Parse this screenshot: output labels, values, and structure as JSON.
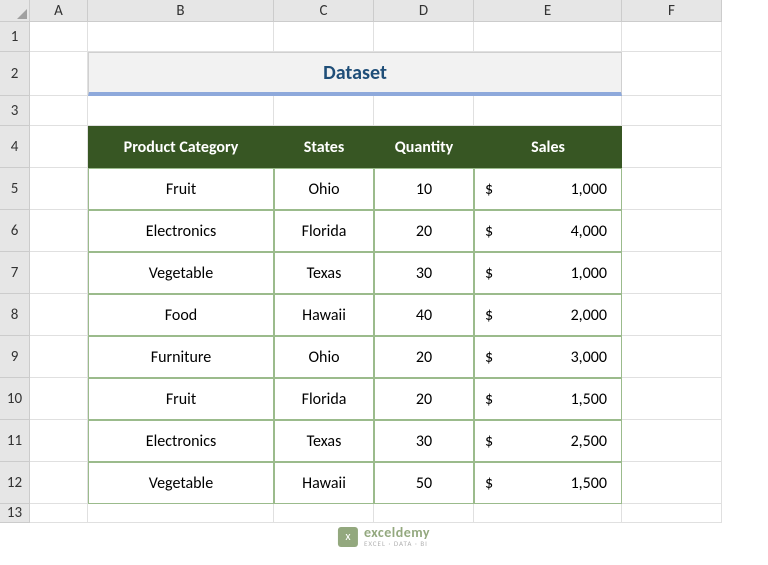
{
  "columns": [
    "A",
    "B",
    "C",
    "D",
    "E",
    "F"
  ],
  "rows": [
    "1",
    "2",
    "3",
    "4",
    "5",
    "6",
    "7",
    "8",
    "9",
    "10",
    "11",
    "12",
    "13"
  ],
  "title": "Dataset",
  "headers": {
    "b": "Product Category",
    "c": "States",
    "d": "Quantity",
    "e": "Sales"
  },
  "data": [
    {
      "category": "Fruit",
      "state": "Ohio",
      "qty": "10",
      "currency": "$",
      "sales": "1,000"
    },
    {
      "category": "Electronics",
      "state": "Florida",
      "qty": "20",
      "currency": "$",
      "sales": "4,000"
    },
    {
      "category": "Vegetable",
      "state": "Texas",
      "qty": "30",
      "currency": "$",
      "sales": "1,000"
    },
    {
      "category": "Food",
      "state": "Hawaii",
      "qty": "40",
      "currency": "$",
      "sales": "2,000"
    },
    {
      "category": "Furniture",
      "state": "Ohio",
      "qty": "20",
      "currency": "$",
      "sales": "3,000"
    },
    {
      "category": "Fruit",
      "state": "Florida",
      "qty": "20",
      "currency": "$",
      "sales": "1,500"
    },
    {
      "category": "Electronics",
      "state": "Texas",
      "qty": "30",
      "currency": "$",
      "sales": "2,500"
    },
    {
      "category": "Vegetable",
      "state": "Hawaii",
      "qty": "50",
      "currency": "$",
      "sales": "1,500"
    }
  ],
  "watermark": {
    "brand": "exceldemy",
    "sub": "EXCEL · DATA · BI"
  },
  "chart_data": {
    "type": "table",
    "title": "Dataset",
    "columns": [
      "Product Category",
      "States",
      "Quantity",
      "Sales"
    ],
    "rows": [
      [
        "Fruit",
        "Ohio",
        10,
        1000
      ],
      [
        "Electronics",
        "Florida",
        20,
        4000
      ],
      [
        "Vegetable",
        "Texas",
        30,
        1000
      ],
      [
        "Food",
        "Hawaii",
        40,
        2000
      ],
      [
        "Furniture",
        "Ohio",
        20,
        3000
      ],
      [
        "Fruit",
        "Florida",
        20,
        1500
      ],
      [
        "Electronics",
        "Texas",
        30,
        2500
      ],
      [
        "Vegetable",
        "Hawaii",
        50,
        1500
      ]
    ]
  }
}
